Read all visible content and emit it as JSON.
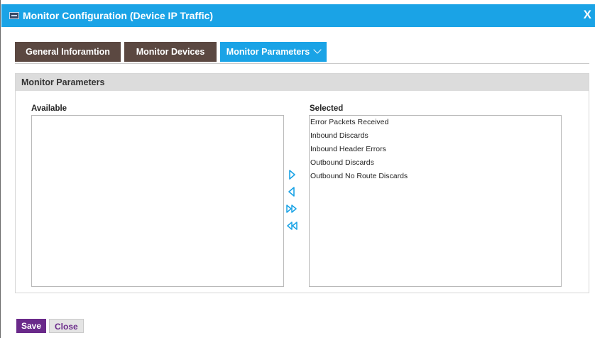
{
  "dialog": {
    "title": "Monitor Configuration (Device IP Traffic)",
    "close_symbol": "X"
  },
  "tabs": [
    {
      "label": "General Inforamtion"
    },
    {
      "label": "Monitor Devices"
    },
    {
      "label": "Monitor Parameters"
    }
  ],
  "active_tab": "Monitor Parameters",
  "panel": {
    "title": "Monitor Parameters",
    "available_label": "Available",
    "selected_label": "Selected",
    "available_items": [],
    "selected_items": [
      "Error Packets Received",
      "Inbound Discards",
      "Inbound Header Errors",
      "Outbound Discards",
      "Outbound No Route Discards"
    ],
    "transfer_icons": [
      "move-right-icon",
      "move-left-icon",
      "move-all-right-icon",
      "move-all-left-icon"
    ]
  },
  "footer": {
    "save_label": "Save",
    "close_label": "Close"
  },
  "colors": {
    "titlebar": "#1aa3e6",
    "tab_inactive": "#5b4841",
    "tab_active": "#1aa3e6",
    "save_button": "#6a2a8a",
    "arrow": "#1aa3e6"
  }
}
